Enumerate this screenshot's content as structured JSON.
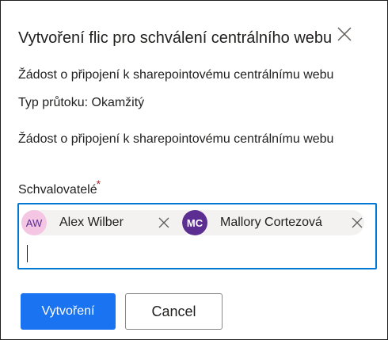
{
  "dialog": {
    "title": "Vytvoření flic pro schválení centrálního webu",
    "line1": "Žádost o připojení k sharepointovému centrálnímu webu",
    "line2": "Typ průtoku: Okamžitý",
    "line3": "Žádost o připojení k sharepointovému centrálnímu webu",
    "approvers_label": "Schvalovatelé",
    "required_mark": "*",
    "approvers": [
      {
        "initials": "AW",
        "name": "Alex Wilber",
        "avatar_color": "#f4c6e3",
        "initials_color": "#5c2e91"
      },
      {
        "initials": "MC",
        "name": "Mallory Cortezová",
        "avatar_color": "#5c2e91",
        "initials_color": "#ffffff"
      }
    ],
    "create_button": "Vytvoření",
    "cancel_button": "Cancel"
  },
  "colors": {
    "primary": "#1a73f0",
    "focus_border": "#0078d4",
    "required": "#a4262c",
    "chip_bg": "#f3f2f1"
  },
  "icons": {
    "close": "close-icon",
    "remove": "remove-icon"
  }
}
